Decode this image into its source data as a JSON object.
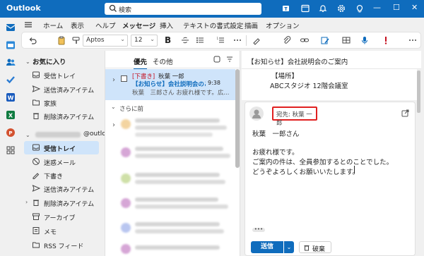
{
  "app": {
    "name": "Outlook"
  },
  "search": {
    "placeholder": "検索"
  },
  "tabs": [
    {
      "label": "ホーム"
    },
    {
      "label": "表示"
    },
    {
      "label": "ヘルプ"
    },
    {
      "label": "メッセージ"
    },
    {
      "label": "挿入"
    },
    {
      "label": "テキストの書式設定"
    },
    {
      "label": "描画"
    },
    {
      "label": "オプション"
    }
  ],
  "ribbon": {
    "font_name": "Aptos",
    "font_size": "12",
    "bold": "B"
  },
  "folders": {
    "favorites_header": "お気に入り",
    "favorites": [
      {
        "label": "受信トレイ",
        "icon": "inbox-icon"
      },
      {
        "label": "送信済みアイテム",
        "icon": "send-icon"
      },
      {
        "label": "家族",
        "icon": "folder-icon"
      },
      {
        "label": "削除済みアイテム",
        "icon": "trash-icon"
      }
    ],
    "account_suffix": "@outlo...",
    "account_items": [
      {
        "label": "受信トレイ",
        "icon": "inbox-icon",
        "selected": true
      },
      {
        "label": "迷惑メール",
        "icon": "junk-icon"
      },
      {
        "label": "下書き",
        "icon": "draft-icon"
      },
      {
        "label": "送信済みアイテム",
        "icon": "send-icon"
      },
      {
        "label": "削除済みアイテム",
        "icon": "trash-icon"
      },
      {
        "label": "アーカイブ",
        "icon": "archive-icon"
      },
      {
        "label": "メモ",
        "icon": "note-icon"
      },
      {
        "label": "RSS フィード",
        "icon": "folder-icon"
      }
    ]
  },
  "list": {
    "tab_focused": "優先",
    "tab_other": "その他",
    "selected_msg": {
      "draft_tag": "[下書き]",
      "sender": "秋葉 一郎",
      "subject": "【お知らせ】会社説明会のご...",
      "time": "9:38",
      "preview": "秋葉　三郎さん お疲れ様です。広..."
    },
    "section_label": "さらに前"
  },
  "reading": {
    "subject": "【お知らせ】会社説明会のご案内",
    "place_label": "【場所】",
    "place_value": "ABCスタジオ 12階会議室",
    "to_label": "宛先:",
    "to_name": "秋葉 一郎",
    "body": {
      "greeting": "秋葉　一郎さん",
      "line1": "お疲れ様です。",
      "line2": "ご案内の件は、全員参加するとのことでした。",
      "line3": "どうぞよろしくお願いいたします。"
    },
    "send_label": "送信",
    "discard_label": "破棄"
  },
  "colors": {
    "accent": "#0f6cbd",
    "highlight": "#e02020",
    "selected": "#cfe4fa"
  }
}
